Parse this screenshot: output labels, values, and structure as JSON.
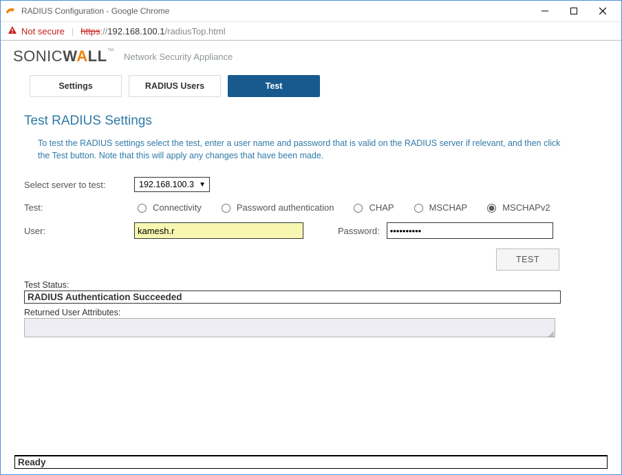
{
  "window": {
    "title": "RADIUS Configuration - Google Chrome"
  },
  "addressbar": {
    "not_secure": "Not secure",
    "scheme": "https",
    "sep": "://",
    "host": "192.168.100.1",
    "path": "/radiusTop.html"
  },
  "brand": {
    "logo_pre": "SONIC",
    "logo_w": "W",
    "logo_a": "A",
    "logo_post": "LL",
    "tm": "™",
    "subtitle": "Network Security Appliance"
  },
  "tabs": {
    "settings": "Settings",
    "radius_users": "RADIUS Users",
    "test": "Test"
  },
  "section": {
    "title": "Test RADIUS Settings",
    "intro": "To test the RADIUS settings select the test, enter a user name and password that is valid on the RADIUS server if relevant, and then click the Test button. Note that this will apply any changes that have been made."
  },
  "form": {
    "server_label": "Select server to test:",
    "server_value": "192.168.100.3",
    "test_label": "Test:",
    "opt_conn": "Connectivity",
    "opt_passauth": "Password authentication",
    "opt_chap": "CHAP",
    "opt_mschap": "MSCHAP",
    "opt_mschapv2": "MSCHAPv2",
    "user_label": "User:",
    "user_value": "kamesh.r",
    "password_label": "Password:",
    "password_value": "••••••••••",
    "test_button": "TEST"
  },
  "status": {
    "label": "Test Status:",
    "value": "RADIUS Authentication Succeeded",
    "attr_label": "Returned User Attributes:"
  },
  "footer": {
    "ready": "Ready"
  }
}
